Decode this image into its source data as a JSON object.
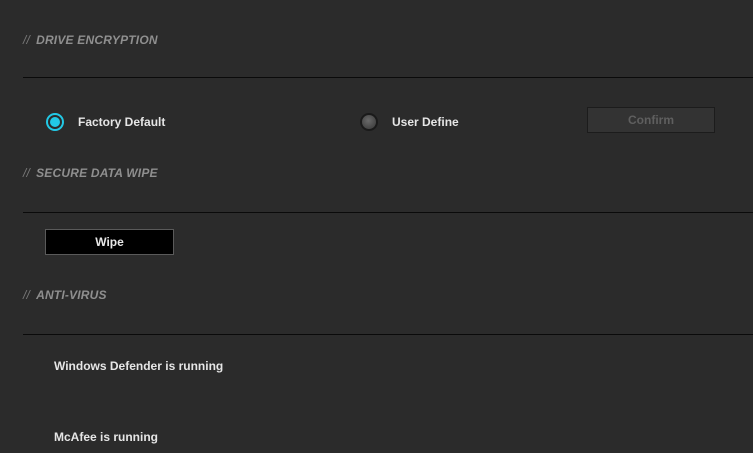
{
  "sections": {
    "drive_encryption": {
      "mark": "//",
      "title": "DRIVE ENCRYPTION",
      "options": [
        {
          "label": "Factory Default",
          "selected": true
        },
        {
          "label": "User Define",
          "selected": false
        }
      ],
      "confirm_label": "Confirm"
    },
    "secure_data_wipe": {
      "mark": "//",
      "title": "SECURE DATA WIPE",
      "wipe_label": "Wipe"
    },
    "anti_virus": {
      "mark": "//",
      "title": "ANTI-VIRUS",
      "items": [
        "Windows Defender is running",
        "McAfee is running"
      ]
    }
  },
  "colors": {
    "accent": "#22c9e6",
    "background": "#2b2b2b",
    "header_text": "#8f8f8f"
  }
}
